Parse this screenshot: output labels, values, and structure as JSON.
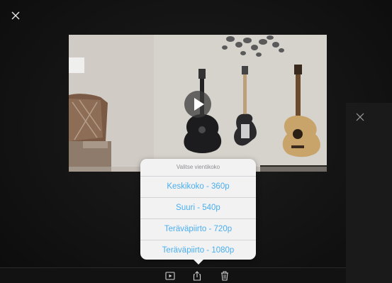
{
  "export_popover": {
    "title": "Valitse vientikoko",
    "options": [
      {
        "label": "Keskikoko - 360p"
      },
      {
        "label": "Suuri - 540p"
      },
      {
        "label": "Teräväpiirto - 720p"
      },
      {
        "label": "Teräväpiirto - 1080p"
      }
    ]
  },
  "toolbar": {
    "items": [
      "play-icon",
      "share-icon",
      "trash-icon"
    ]
  },
  "colors": {
    "accent": "#4aaef0",
    "popover_bg": "#f2f2f2",
    "popover_title": "#8e8e93",
    "background": "#141414"
  }
}
